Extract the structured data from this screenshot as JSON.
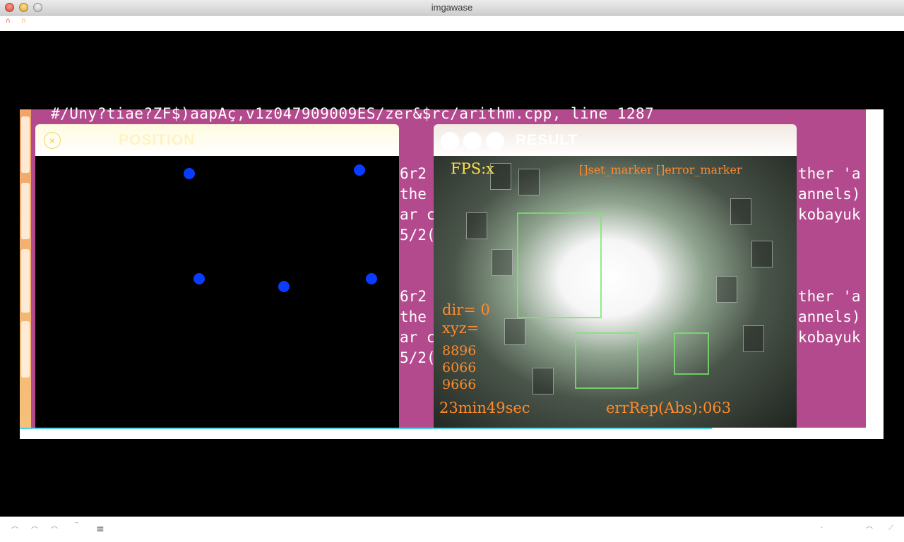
{
  "window": {
    "title": "imgawase"
  },
  "terminal": {
    "top_line": "#/Uny?tiae?ZF$)aapAç,v1z047909009ES/zer&$rc/arithm.cpp, line 1287",
    "block_a": [
      "6r2",
      "the",
      "ar c",
      "5/2("
    ],
    "block_b": [
      "6r2",
      "the",
      "ar c",
      "5/2("
    ],
    "right_a": [
      "ther 'a",
      "annels)",
      "kobayuk"
    ],
    "right_b": [
      "ther 'a",
      "annels)",
      "kobayuk"
    ]
  },
  "position_window": {
    "title": "POSITION",
    "close_glyph": "×",
    "dots": [
      {
        "id": "dot-1"
      },
      {
        "id": "dot-2"
      },
      {
        "id": "dot-3"
      },
      {
        "id": "dot-4"
      },
      {
        "id": "dot-5"
      }
    ]
  },
  "result_window": {
    "title": "RESULT",
    "fps": "FPS:x",
    "legend": "[]set_marker []error_marker",
    "dir": "dir= 0",
    "xyz_label": "xyz=",
    "xyz_values": [
      "8896",
      "6066",
      "9666"
    ],
    "elapsed": "23min49sec",
    "error_label": "errRep(Abs):063"
  },
  "colors": {
    "purple_desktop": "#b34a8e",
    "marker_blue": "#0a3cff",
    "overlay_yellow": "#ffe14a",
    "overlay_orange": "#ff8a2b",
    "cyan_line": "#4ad3e6"
  },
  "statusbar": {
    "menu_icon": "hamburger-menu-icon"
  }
}
